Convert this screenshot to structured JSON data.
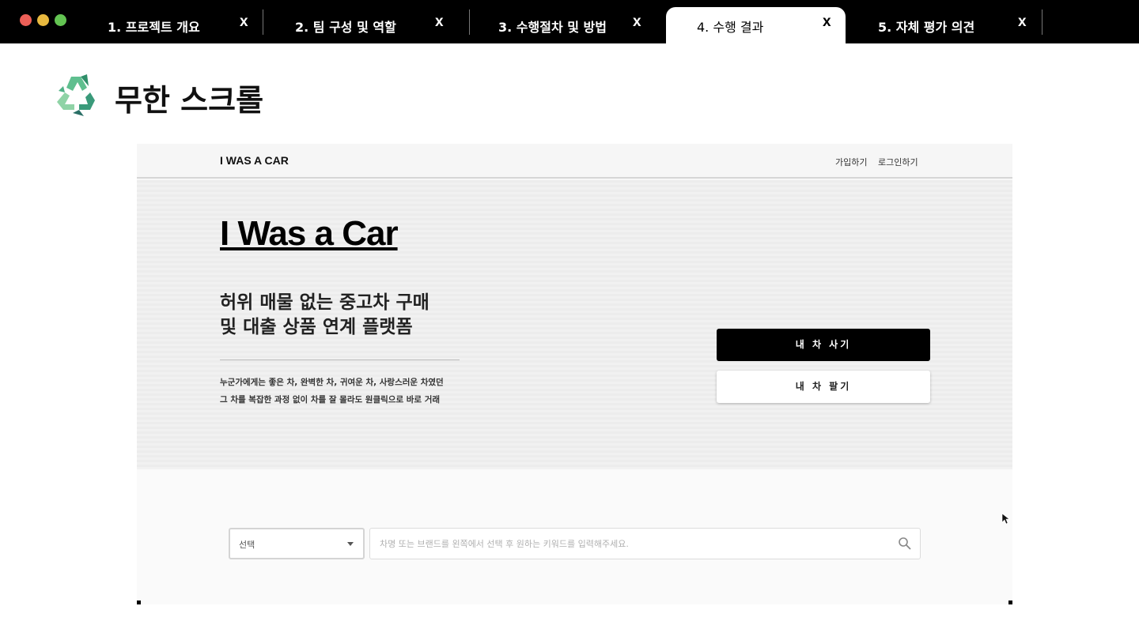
{
  "tabs": [
    {
      "label": "1. 프로젝트 개요",
      "close": "x",
      "active": false
    },
    {
      "label": "2. 팀 구성 및 역할",
      "close": "x",
      "active": false
    },
    {
      "label": "3. 수행절차 및 방법",
      "close": "x",
      "active": false
    },
    {
      "label": "4. 수행 결과",
      "close": "x",
      "active": true
    },
    {
      "label": "5. 자체 평가 의견",
      "close": "x",
      "active": false
    }
  ],
  "heading": {
    "icon": "recycle-icon",
    "title": "무한 스크롤"
  },
  "site": {
    "brand": "I WAS A CAR",
    "nav": {
      "signup": "가입하기",
      "login": "로그인하기"
    },
    "hero": {
      "title": "I Was a Car",
      "subtitle_line1": "허위 매물 없는 중고차 구매",
      "subtitle_line2": "및 대출 상품 연계 플랫폼",
      "desc_line1": "누군가에게는 좋은 차, 완벽한 차, 귀여운 차, 사랑스러운 차였던",
      "desc_line2": "그 차를 복잡한 과정 없이 차를 잘 몰라도 원클릭으로 바로 거래"
    },
    "buttons": {
      "buy": "내 차 사기",
      "sell": "내 차 팔기"
    },
    "search": {
      "select_value": "선택",
      "placeholder": "차명 또는 브랜드를 왼쪽에서 선택 후 원하는 키워드를 입력해주세요."
    }
  },
  "colors": {
    "tabbar": "#000000",
    "accent_button": "#000000",
    "traffic_red": "#ec5f57",
    "traffic_yellow": "#e8b93f",
    "traffic_green": "#63c452"
  }
}
